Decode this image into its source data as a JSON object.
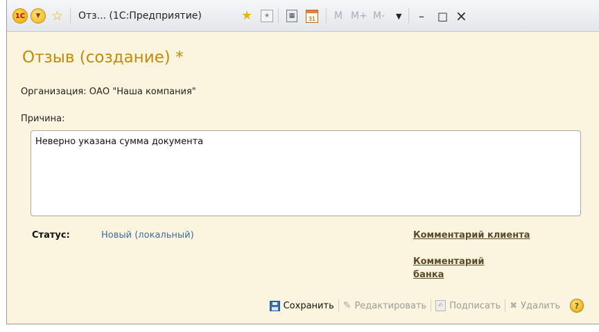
{
  "window": {
    "title": "Отз...  (1С:Предприятие)",
    "logo_text": "1С",
    "icons": {
      "app_logo": "1c-logo-icon",
      "menu": "menu-dropdown-icon",
      "favorite": "star-icon",
      "add_favorite": "star-add-icon",
      "link": "link-icon",
      "calculator": "calculator-icon",
      "calendar": "calendar-icon"
    },
    "calendar_number": "31",
    "memory_buttons": [
      "M",
      "M+",
      "M-"
    ],
    "min_label": "–",
    "max_label": "□",
    "close_label": "×"
  },
  "form": {
    "title": "Отзыв (создание) *",
    "organization_label": "Организация:",
    "organization_value": "ОАО \"Наша компания\"",
    "reason_label": "Причина:",
    "reason_value": "Неверно указана сумма документа",
    "status_label": "Статус:",
    "status_value": "Новый (локальный)",
    "client_comment_link": "Комментарий клиента",
    "bank_comment_link": "Комментарий банка"
  },
  "commands": {
    "save": "Сохранить",
    "edit": "Редактировать",
    "sign": "Подписать",
    "delete": "Удалить",
    "help": "?"
  },
  "colors": {
    "form_background": "#fbf4de",
    "title_color": "#c48a0a",
    "status_value_color": "#3c6ea8",
    "link_color": "#5a4a2a"
  }
}
